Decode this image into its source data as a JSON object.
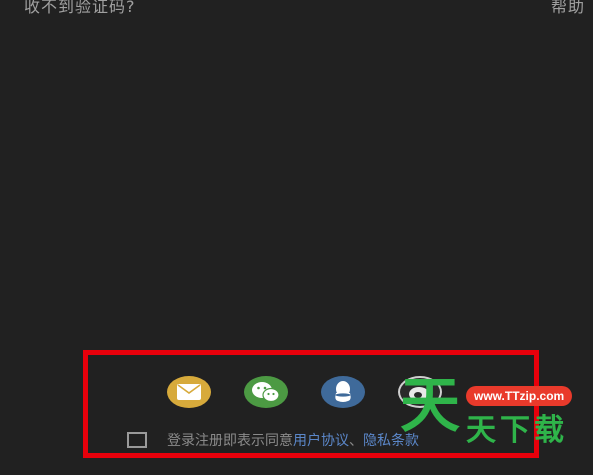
{
  "header": {
    "no_code": "收不到验证码?",
    "help": "帮助"
  },
  "login_options": [
    "email-icon",
    "wechat-icon",
    "qq-icon",
    "weibo-icon"
  ],
  "agreement": {
    "prefix": "登录注册即表示同意",
    "user_agreement": "用户协议",
    "separator": "、",
    "privacy_policy": "隐私条款"
  },
  "watermark": {
    "big_char": "天",
    "url": "www.TTzip.com",
    "name": "天下载"
  },
  "colors": {
    "background": "#212121",
    "highlight": "#e8000b",
    "email": "#d7aa3b",
    "wechat": "#4c9a43",
    "qq": "#3f6a9a",
    "link": "#5b87c9",
    "watermark_green": "#2fb44a",
    "watermark_red": "#e93a2b"
  }
}
